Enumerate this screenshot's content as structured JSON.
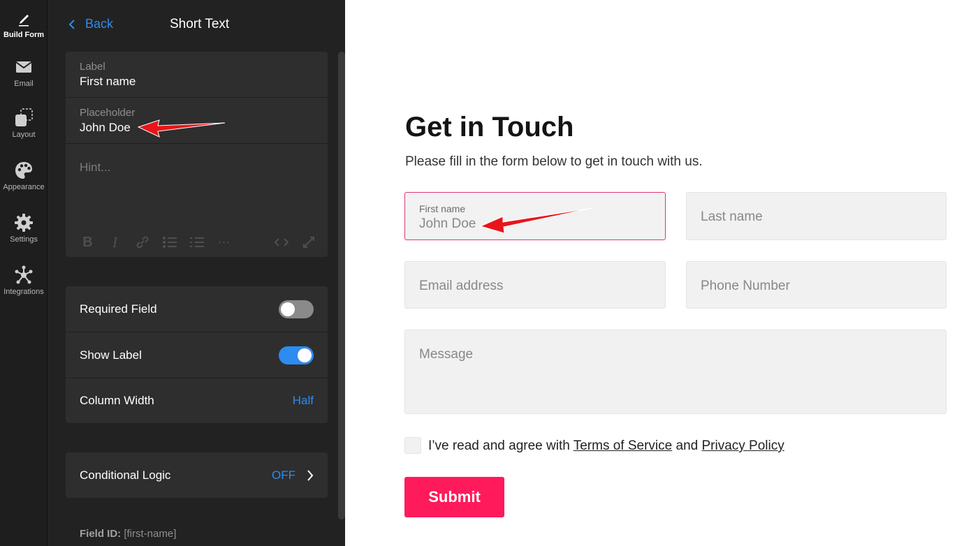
{
  "rail": {
    "items": [
      {
        "label": "Build Form",
        "icon": "pencil-icon"
      },
      {
        "label": "Email",
        "icon": "envelope-icon"
      },
      {
        "label": "Layout",
        "icon": "layout-icon"
      },
      {
        "label": "Appearance",
        "icon": "palette-icon"
      },
      {
        "label": "Settings",
        "icon": "gear-icon"
      },
      {
        "label": "Integrations",
        "icon": "integrations-icon"
      }
    ]
  },
  "panel": {
    "back_label": "Back",
    "title": "Short Text",
    "label_field": {
      "label": "Label",
      "value": "First name"
    },
    "placeholder_field": {
      "label": "Placeholder",
      "value": "John Doe"
    },
    "hint_placeholder": "Hint...",
    "required": {
      "label": "Required Field",
      "on": false
    },
    "show_label": {
      "label": "Show Label",
      "on": true
    },
    "column_width": {
      "label": "Column Width",
      "value": "Half"
    },
    "conditional_logic": {
      "label": "Conditional Logic",
      "value": "OFF"
    },
    "field_id": {
      "label": "Field ID:",
      "value": "[first-name]"
    }
  },
  "form": {
    "title": "Get in Touch",
    "subtitle": "Please fill in the form below to get in touch with us.",
    "first_name": {
      "label": "First name",
      "placeholder": "John Doe"
    },
    "last_name": {
      "placeholder": "Last name"
    },
    "email": {
      "placeholder": "Email address"
    },
    "phone": {
      "placeholder": "Phone Number"
    },
    "message": {
      "placeholder": "Message"
    },
    "agree_prefix": "I’ve read and agree with ",
    "terms": "Terms of Service",
    "and": " and ",
    "privacy": "Privacy Policy",
    "submit": "Submit"
  },
  "colors": {
    "accent_blue": "#2d8cf0",
    "submit_pink": "#ff1a5b",
    "focus_border": "#e0357a",
    "arrow_red": "#e8151b"
  }
}
